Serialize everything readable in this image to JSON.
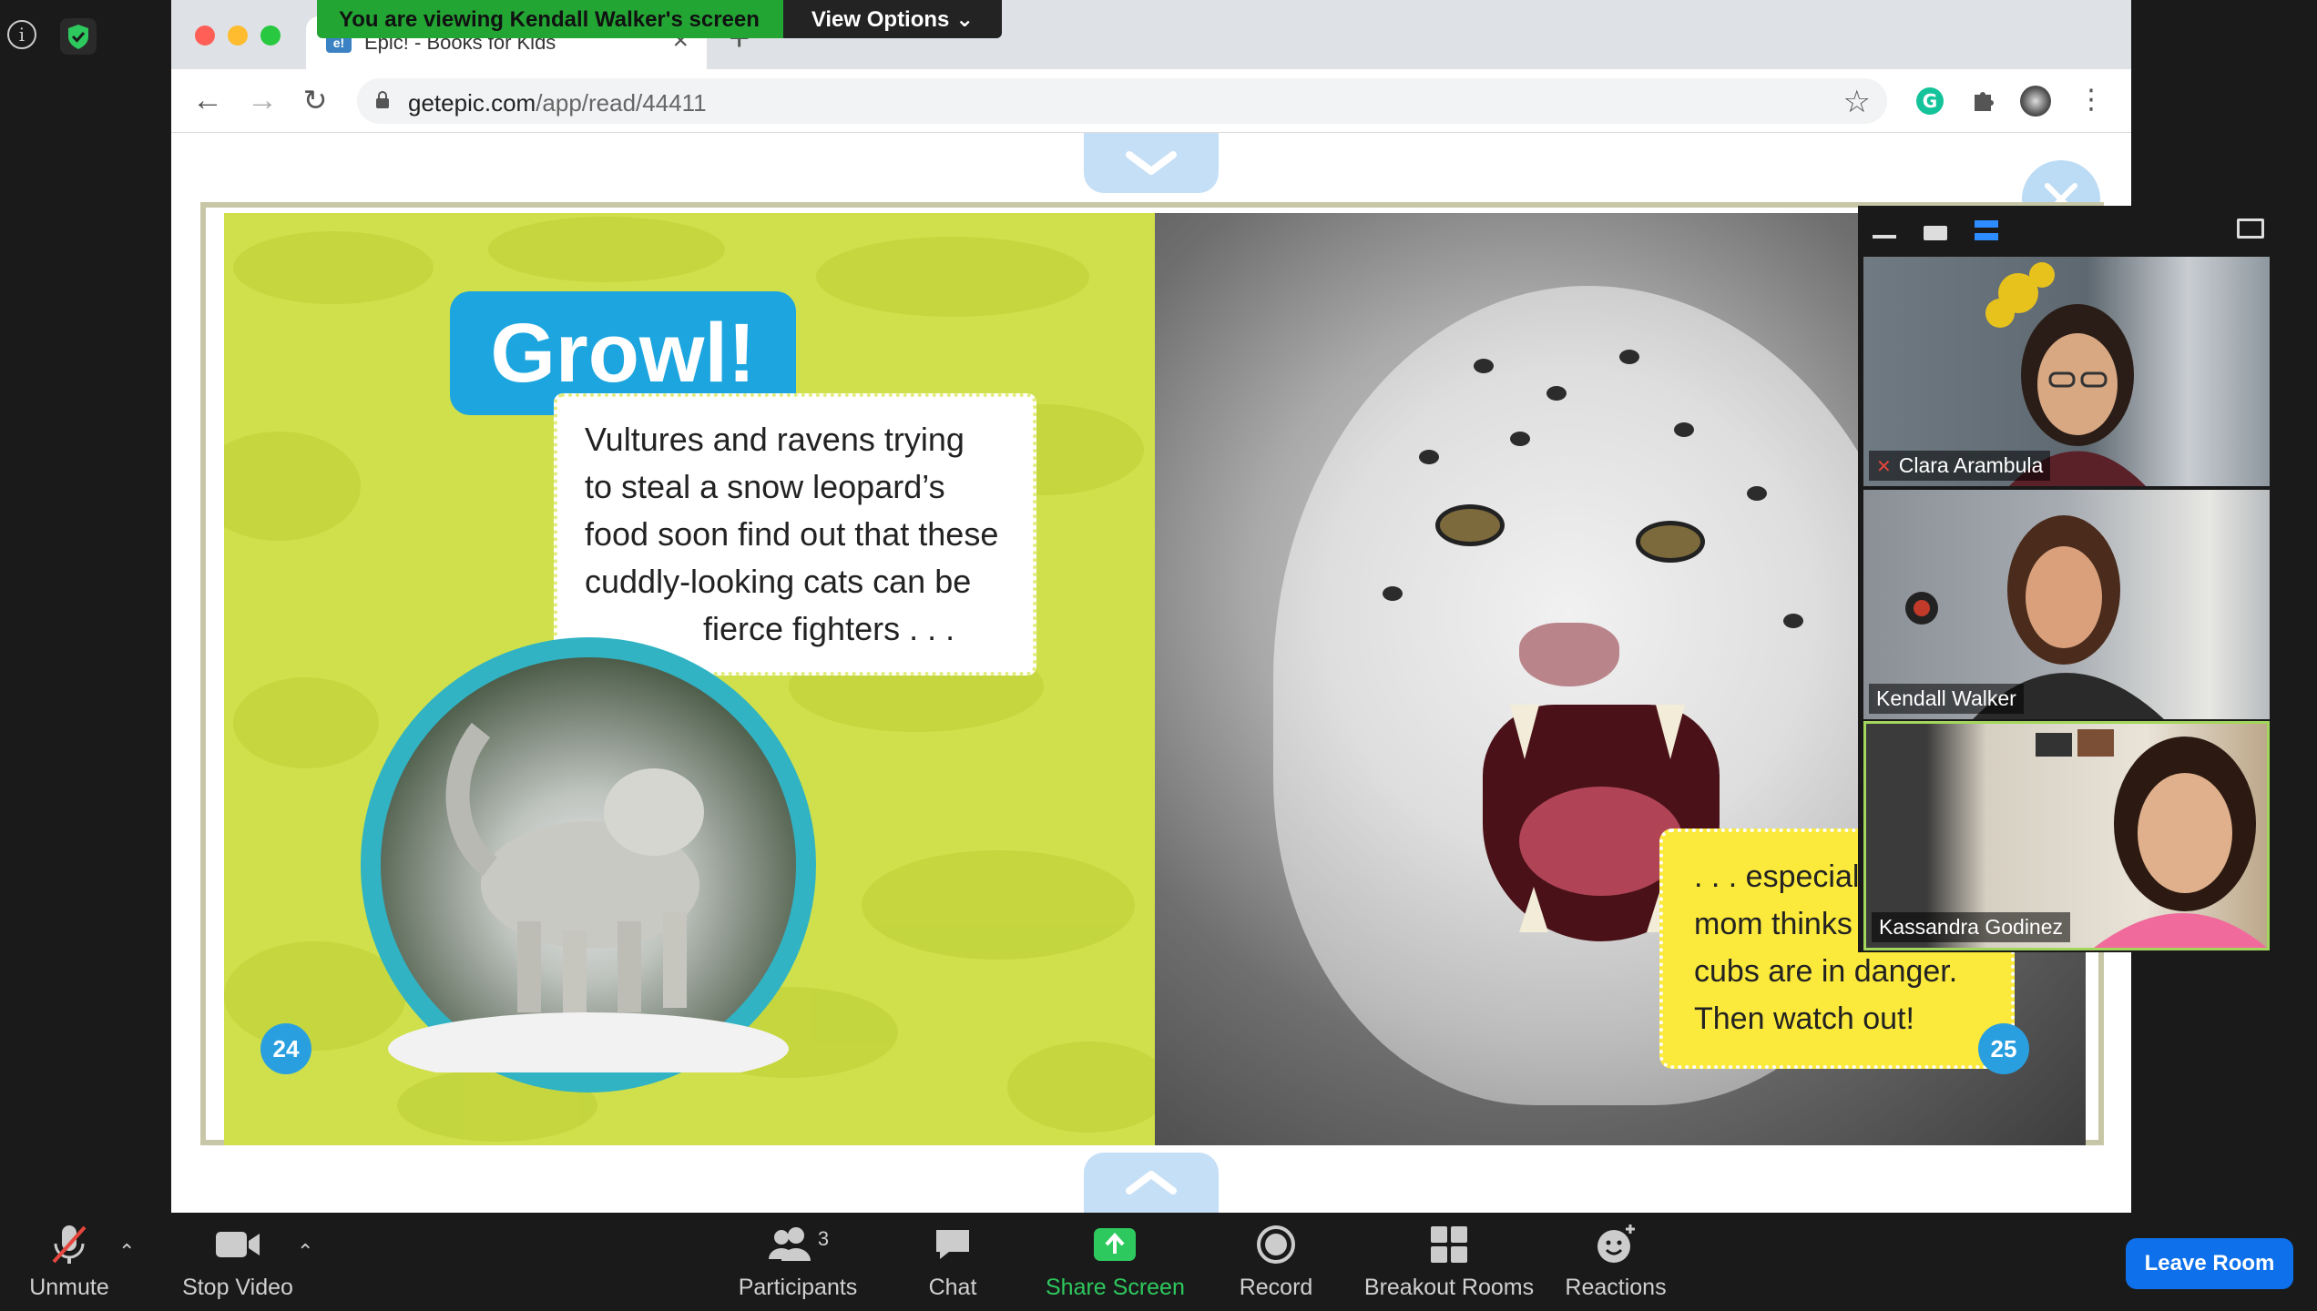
{
  "zoom": {
    "banner": {
      "viewing_text": "You are viewing Kendall Walker's screen",
      "view_options_label": "View Options ⌄"
    },
    "participants": [
      {
        "name": "Clara Arambula",
        "muted": true
      },
      {
        "name": "Kendall Walker",
        "muted": false
      },
      {
        "name": "Kassandra Godinez",
        "muted": false
      }
    ],
    "toolbar": {
      "unmute_label": "Unmute",
      "stop_video_label": "Stop Video",
      "participants_label": "Participants",
      "participants_count": "3",
      "chat_label": "Chat",
      "share_screen_label": "Share Screen",
      "record_label": "Record",
      "breakout_rooms_label": "Breakout Rooms",
      "reactions_label": "Reactions",
      "leave_label": "Leave Room"
    },
    "colors": {
      "share_green": "#2ec95e",
      "leave_blue": "#0e71eb",
      "banner_green": "#23a534"
    }
  },
  "browser": {
    "tab_title": "Epic! - Books for Kids",
    "url_host": "getepic.com",
    "url_path": "/app/read/44411"
  },
  "book": {
    "heading": "Growl!",
    "left_text_lines": [
      "Vultures and ravens trying",
      "to steal a snow leopard’s",
      "food soon find out that these",
      "cuddly-looking cats can be",
      "fierce  fighters . . ."
    ],
    "right_text_lines": [
      ". . . especially",
      "mom thinks",
      "cubs are in danger.",
      "Then watch out!"
    ],
    "left_page_number": "24",
    "right_page_number": "25"
  }
}
